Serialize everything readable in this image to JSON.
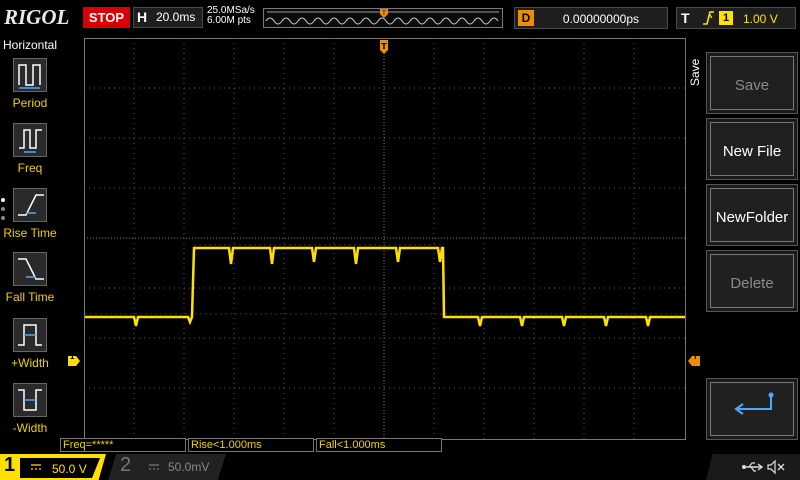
{
  "brand": "RIGOL",
  "status": {
    "run_state": "STOP",
    "run_state_color": "#d80000"
  },
  "horizontal": {
    "letter": "H",
    "timebase": "20.0ms",
    "sample_rate": "25.0MSa/s",
    "memory_depth": "6.00M pts"
  },
  "delay": {
    "letter": "D",
    "value": "0.00000000ps"
  },
  "trigger": {
    "letter": "T",
    "source": "1",
    "level": "1.00 V",
    "edge_icon": "rising-edge-icon"
  },
  "left_menu": {
    "title": "Horizontal",
    "items": [
      {
        "label": "Period",
        "icon": "period-icon"
      },
      {
        "label": "Freq",
        "icon": "frequency-icon"
      },
      {
        "label": "Rise Time",
        "icon": "rise-time-icon"
      },
      {
        "label": "Fall Time",
        "icon": "fall-time-icon"
      },
      {
        "label": "+Width",
        "icon": "positive-width-icon"
      },
      {
        "label": "-Width",
        "icon": "negative-width-icon"
      }
    ]
  },
  "right_menu": {
    "title": "Save",
    "keys": [
      {
        "label": "Save",
        "enabled": false
      },
      {
        "label": "New File",
        "enabled": true
      },
      {
        "label": "NewFolder",
        "enabled": true
      },
      {
        "label": "Delete",
        "enabled": false
      },
      {
        "label": "",
        "icon": "return-arrow-icon",
        "enabled": true
      }
    ]
  },
  "measurements": [
    {
      "label": "Freq=*****"
    },
    {
      "label": "Rise<1.000ms"
    },
    {
      "label": "Fall<1.000ms"
    }
  ],
  "channels": [
    {
      "number": "1",
      "scale": "50.0 V",
      "coupling_icon": "dc-coupling-icon",
      "color": "#ffe000",
      "active": true
    },
    {
      "number": "2",
      "scale": "50.0mV",
      "coupling_icon": "dc-coupling-icon",
      "color": "#888888",
      "active": false
    }
  ],
  "status_icons": [
    "usb-icon",
    "mute-icon"
  ],
  "markers": {
    "channel_ground": "1",
    "trigger_level": "T",
    "trigger_position": "T"
  },
  "colors": {
    "trace": "#ffe000",
    "trigger_marker": "#f08c00",
    "grid": "#5a5a5a"
  }
}
